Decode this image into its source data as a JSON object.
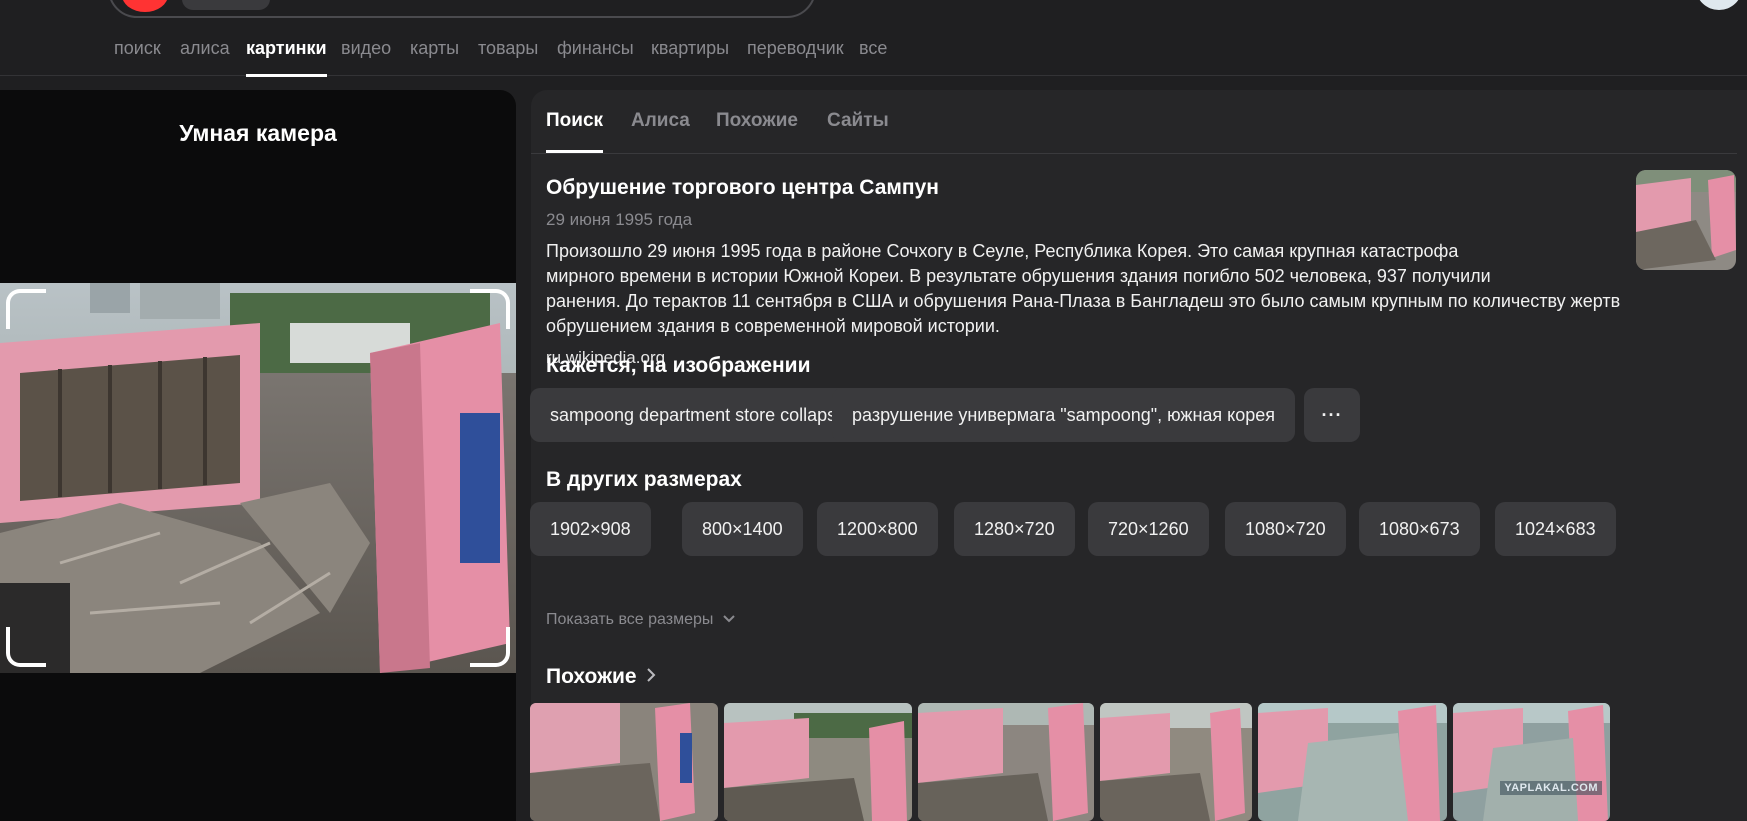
{
  "nav": {
    "tabs": [
      "поиск",
      "алиса",
      "картинки",
      "видео",
      "карты",
      "товары",
      "финансы",
      "квартиры",
      "переводчик",
      "все"
    ],
    "active": "картинки"
  },
  "left": {
    "title": "Умная камера"
  },
  "right": {
    "tabs": [
      "Поиск",
      "Алиса",
      "Похожие",
      "Сайты"
    ],
    "active_tab": "Поиск",
    "fact": {
      "title": "Обрушение торгового центра Сампун",
      "date": "29 июня 1995 года",
      "line1": "Произошло 29 июня 1995 года в районе Сочхогу в Сеуле, Республика Корея. Это самая крупная катастрофа",
      "line2": "мирного времени в истории Южной Кореи. В результате обрушения здания погибло 502 человека, 937 получили",
      "line3": "ранения. До терактов 11 сентября в США и обрушения Рана-Плаза в Бангладеш это было самым крупным по количеству жертв",
      "line4": "обрушением здания в современной мировой истории.",
      "source": "ru.wikipedia.org"
    },
    "seems": {
      "title": "Кажется, на изображении",
      "chips": [
        "sampoong department store collapse",
        "разрушение универмага \"sampoong\", южная корея"
      ],
      "more_label": "···"
    },
    "sizes": {
      "title": "В других размерах",
      "items": [
        "1902×908",
        "800×1400",
        "1200×800",
        "1280×720",
        "720×1260",
        "1080×720",
        "1080×673",
        "1024×683"
      ],
      "show_all": "Показать все размеры"
    },
    "similar": {
      "title": "Похожие",
      "watermark": "YAPLAKAL.COM"
    }
  },
  "colors": {
    "background": "#1f1f21",
    "panel": "#262628",
    "chip": "#3a3a3d",
    "building_pink": "#e58fa6"
  }
}
